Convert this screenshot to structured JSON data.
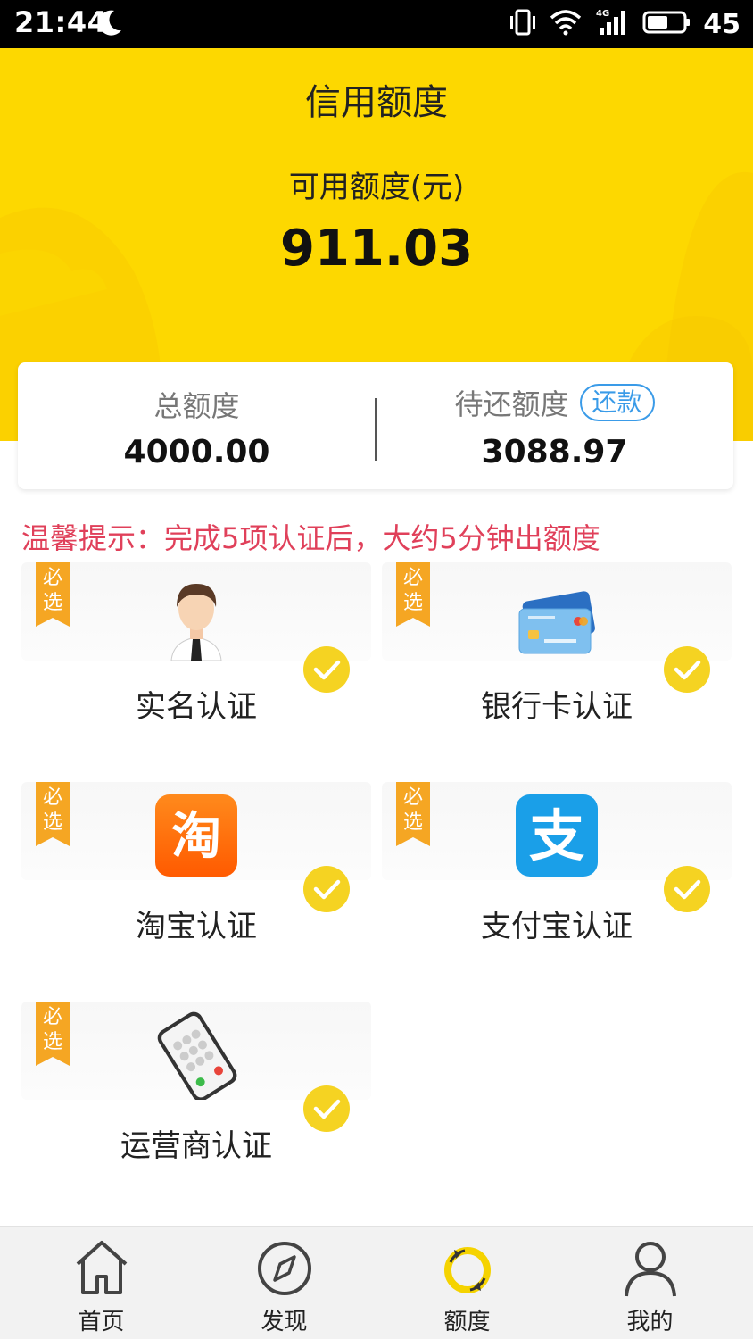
{
  "status_bar": {
    "time": "21:44",
    "battery_level": "45",
    "network": "4G",
    "icons": [
      "moon-icon",
      "vibrate-icon",
      "wifi-icon",
      "signal-icon",
      "battery-icon"
    ]
  },
  "header": {
    "title": "信用额度",
    "available_label": "可用额度(元)",
    "available_value": "911.03",
    "background_color": "#fdd800"
  },
  "summary": {
    "total_label": "总额度",
    "total_value": "4000.00",
    "pending_label": "待还额度",
    "pending_value": "3088.97",
    "repay_button": "还款",
    "repay_button_color": "#3a9be8"
  },
  "tip": {
    "text": "温馨提示：完成5项认证后，大约5分钟出额度",
    "color": "#e0405a"
  },
  "auth_items": [
    {
      "label": "实名认证",
      "badge": "必选",
      "icon": "person-avatar-icon",
      "completed": true
    },
    {
      "label": "银行卡认证",
      "badge": "必选",
      "icon": "credit-card-icon",
      "completed": true
    },
    {
      "label": "淘宝认证",
      "badge": "必选",
      "icon": "taobao-icon",
      "completed": true
    },
    {
      "label": "支付宝认证",
      "badge": "必选",
      "icon": "alipay-icon",
      "completed": true
    },
    {
      "label": "运营商认证",
      "badge": "必选",
      "icon": "mobile-phone-icon",
      "completed": true
    }
  ],
  "bottom_nav": {
    "items": [
      {
        "label": "首页",
        "icon": "home-icon",
        "active": false
      },
      {
        "label": "发现",
        "icon": "compass-icon",
        "active": false
      },
      {
        "label": "额度",
        "icon": "refresh-icon",
        "active": true
      },
      {
        "label": "我的",
        "icon": "user-icon",
        "active": false
      }
    ],
    "active_color": "#f5d300"
  }
}
